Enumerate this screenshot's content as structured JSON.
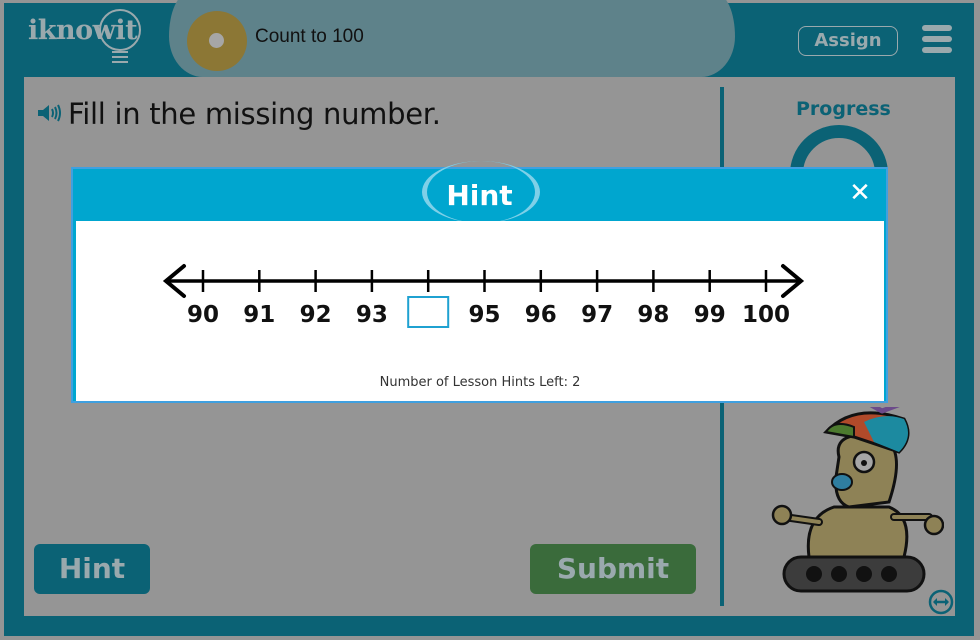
{
  "app": {
    "logo_text": "iknowit",
    "lesson_title": "Count to 100",
    "assign_label": "Assign",
    "menu_icon": "hamburger-menu-icon"
  },
  "question": {
    "speaker_icon": "speaker-icon",
    "text": "Fill in the missing number."
  },
  "progress": {
    "label": "Progress"
  },
  "buttons": {
    "hint_label": "Hint",
    "submit_label": "Submit"
  },
  "modal": {
    "title": "Hint",
    "close_icon": "close-icon",
    "number_line": {
      "ticks": [
        "90",
        "91",
        "92",
        "93",
        "",
        "95",
        "96",
        "97",
        "98",
        "99",
        "100"
      ],
      "missing_index": 4
    },
    "hints_left_text": "Number of Lesson Hints Left: 2"
  },
  "colors": {
    "frame": "#0b6275",
    "modal_header": "#00a6cf",
    "missing_box": "#1fa1d1",
    "submit": "#3a6b3b"
  }
}
